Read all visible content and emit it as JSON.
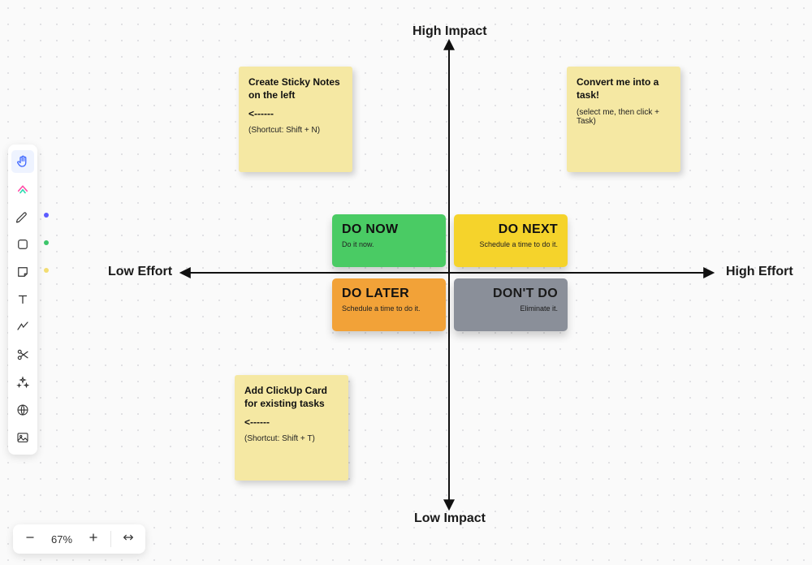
{
  "axes": {
    "top": "High Impact",
    "bottom": "Low Impact",
    "left": "Low Effort",
    "right": "High Effort"
  },
  "stickies": {
    "note1": {
      "title": "Create Sticky Notes on the left",
      "arrow": "<------",
      "sub": "(Shortcut: Shift + N)"
    },
    "note2": {
      "title": "Convert me into a task!",
      "sub": "(select me, then click + Task)"
    },
    "note3": {
      "title": "Add ClickUp Card for existing tasks",
      "arrow": "<------",
      "sub": "(Shortcut: Shift + T)"
    }
  },
  "blocks": {
    "do_now": {
      "title": "DO NOW",
      "sub": "Do it now."
    },
    "do_next": {
      "title": "DO NEXT",
      "sub": "Schedule a time to do it."
    },
    "do_later": {
      "title": "DO LATER",
      "sub": "Schedule a time to do it."
    },
    "dont_do": {
      "title": "DON'T DO",
      "sub": "Eliminate it."
    }
  },
  "zoom": {
    "level": "67%"
  },
  "toolbar_names": {
    "hand": "hand",
    "clickup": "clickup",
    "pen": "pen",
    "shape": "shape",
    "sticky": "sticky",
    "text": "text",
    "connector": "connector",
    "scissors": "scissors",
    "sparkle": "sparkle",
    "globe": "globe",
    "image": "image"
  }
}
